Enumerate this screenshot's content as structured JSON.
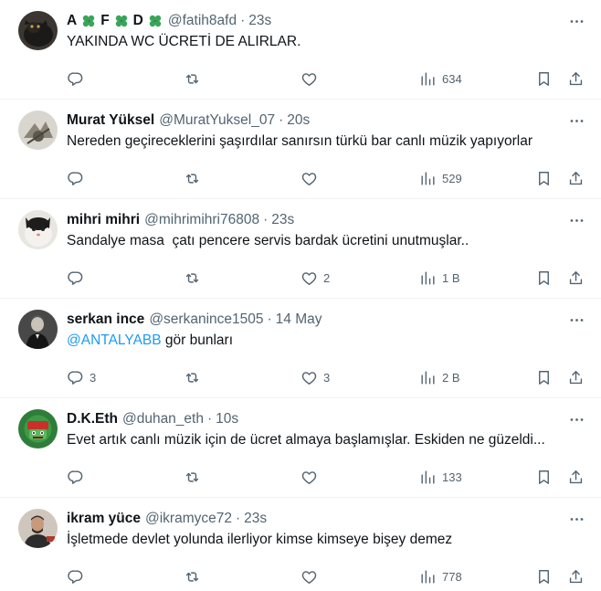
{
  "tweets": [
    {
      "name_parts": [
        "A",
        "F",
        "D"
      ],
      "handle": "@fatih8afd",
      "time": "23s",
      "text": "YAKINDA WC ÜCRETİ DE ALIRLAR.",
      "replies": "",
      "likes": "",
      "views": "634"
    },
    {
      "name": "Murat Yüksel",
      "handle": "@MuratYuksel_07",
      "time": "20s",
      "text": "Nereden geçireceklerini şaşırdılar sanırsın türkü bar canlı müzik yapıyorlar",
      "replies": "",
      "likes": "",
      "views": "529"
    },
    {
      "name": "mihri mihri",
      "handle": "@mihrimihri76808",
      "time": "23s",
      "text": "Sandalye masa  çatı pencere servis bardak ücretini unutmuşlar..",
      "replies": "",
      "likes": "2",
      "views": "1 B"
    },
    {
      "name": "serkan ince",
      "handle": "@serkanince1505",
      "time": "14 May",
      "mention": "@ANTALYABB",
      "text": " gör bunları",
      "replies": "3",
      "likes": "3",
      "views": "2 B"
    },
    {
      "name": "D.K.Eth",
      "handle": "@duhan_eth",
      "time": "10s",
      "text": "Evet artık canlı müzik için de ücret almaya başlamışlar. Eskiden ne güzeldi...",
      "replies": "",
      "likes": "",
      "views": "133"
    },
    {
      "name": "ikram yüce",
      "handle": "@ikramyce72",
      "time": "23s",
      "text": "İşletmede devlet yolunda ilerliyor kimse kimseye bişey demez",
      "replies": "",
      "likes": "",
      "views": "778"
    }
  ],
  "icons": {
    "reply": "reply-icon",
    "retweet": "retweet-icon",
    "like": "heart-icon",
    "views": "views-icon",
    "bookmark": "bookmark-icon",
    "share": "share-icon",
    "more": "more-icon"
  },
  "colors": {
    "text": "#0f1419",
    "secondary": "#536471",
    "link": "#1d9bf0",
    "divider": "#eff3f4",
    "clover": "#3aa55a"
  }
}
